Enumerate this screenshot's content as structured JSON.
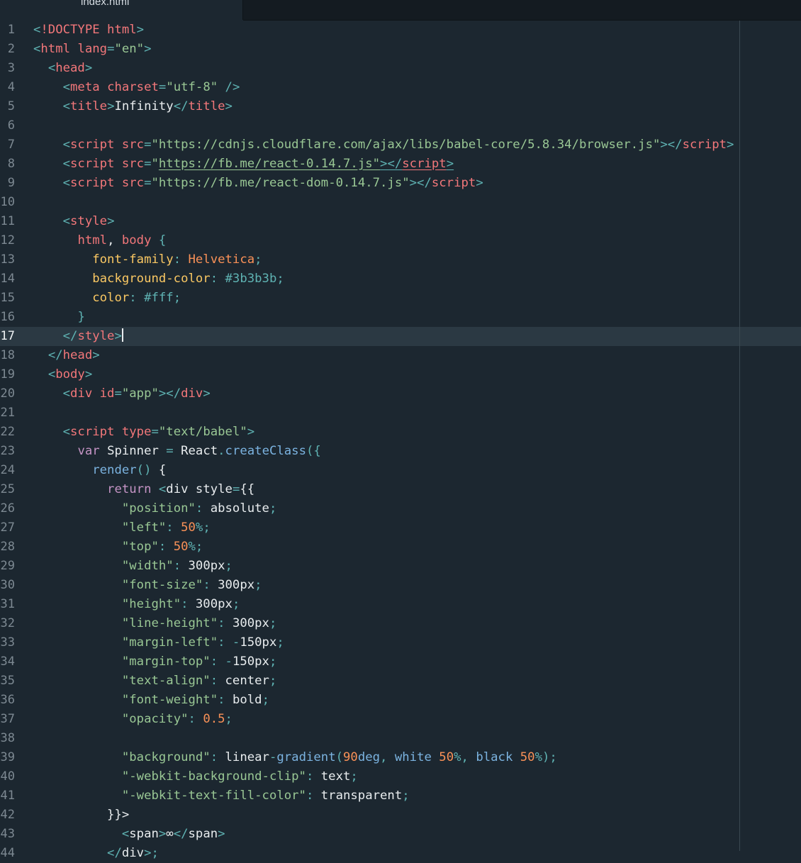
{
  "tab": {
    "filename": "index.html"
  },
  "editor": {
    "active_line": 17,
    "lines": [
      {
        "n": "1",
        "tokens": [
          [
            "p",
            "<"
          ],
          [
            "t",
            "!DOCTYPE html"
          ],
          [
            "p",
            ">"
          ]
        ]
      },
      {
        "n": "2",
        "tokens": [
          [
            "p",
            "<"
          ],
          [
            "t",
            "html "
          ],
          [
            "t",
            "lang"
          ],
          [
            "p",
            "="
          ],
          [
            "s",
            "\"en\""
          ],
          [
            "p",
            ">"
          ]
        ]
      },
      {
        "n": "3",
        "tokens": [
          [
            "",
            "  "
          ],
          [
            "p",
            "<"
          ],
          [
            "t",
            "head"
          ],
          [
            "p",
            ">"
          ]
        ]
      },
      {
        "n": "4",
        "tokens": [
          [
            "",
            "    "
          ],
          [
            "p",
            "<"
          ],
          [
            "t",
            "meta "
          ],
          [
            "t",
            "charset"
          ],
          [
            "p",
            "="
          ],
          [
            "s",
            "\"utf-8\""
          ],
          [
            "p",
            " />"
          ]
        ]
      },
      {
        "n": "5",
        "tokens": [
          [
            "",
            "    "
          ],
          [
            "p",
            "<"
          ],
          [
            "t",
            "title"
          ],
          [
            "p",
            ">"
          ],
          [
            "",
            "Infinity"
          ],
          [
            "p",
            "</"
          ],
          [
            "t",
            "title"
          ],
          [
            "p",
            ">"
          ]
        ]
      },
      {
        "n": "6",
        "tokens": []
      },
      {
        "n": "7",
        "tokens": [
          [
            "",
            "    "
          ],
          [
            "p",
            "<"
          ],
          [
            "t",
            "script "
          ],
          [
            "t",
            "src"
          ],
          [
            "p",
            "="
          ],
          [
            "s",
            "\"https://cdnjs.cloudflare.com/ajax/libs/babel-core/5.8.34/browser.js\""
          ],
          [
            "p",
            "></"
          ],
          [
            "t",
            "script"
          ],
          [
            "p",
            ">"
          ]
        ]
      },
      {
        "n": "8",
        "tokens": [
          [
            "",
            "    "
          ],
          [
            "p",
            "<"
          ],
          [
            "t",
            "script "
          ],
          [
            "t",
            "src"
          ],
          [
            "p",
            "="
          ],
          [
            "s",
            "\""
          ],
          [
            "su",
            "https://fb.me/react-0.14.7.js\""
          ],
          [
            "pu",
            "></"
          ],
          [
            "tu",
            "script"
          ],
          [
            "pu",
            ">"
          ]
        ]
      },
      {
        "n": "9",
        "tokens": [
          [
            "",
            "    "
          ],
          [
            "p",
            "<"
          ],
          [
            "t",
            "script "
          ],
          [
            "t",
            "src"
          ],
          [
            "p",
            "="
          ],
          [
            "s",
            "\"https://fb.me/react-dom-0.14.7.js\""
          ],
          [
            "p",
            "></"
          ],
          [
            "t",
            "script"
          ],
          [
            "p",
            ">"
          ]
        ]
      },
      {
        "n": "10",
        "tokens": []
      },
      {
        "n": "11",
        "tokens": [
          [
            "",
            "    "
          ],
          [
            "p",
            "<"
          ],
          [
            "t",
            "style"
          ],
          [
            "p",
            ">"
          ]
        ]
      },
      {
        "n": "12",
        "tokens": [
          [
            "",
            "      "
          ],
          [
            "t",
            "html"
          ],
          [
            "",
            ", "
          ],
          [
            "t",
            "body"
          ],
          [
            "p",
            " {"
          ]
        ]
      },
      {
        "n": "13",
        "tokens": [
          [
            "",
            "        "
          ],
          [
            "pr",
            "font-family"
          ],
          [
            "p",
            ": "
          ],
          [
            "n",
            "Helvetica"
          ],
          [
            "p",
            ";"
          ]
        ]
      },
      {
        "n": "14",
        "tokens": [
          [
            "",
            "        "
          ],
          [
            "pr",
            "background-color"
          ],
          [
            "p",
            ": "
          ],
          [
            "p",
            "#3b3b3b"
          ],
          [
            "p",
            ";"
          ]
        ]
      },
      {
        "n": "15",
        "tokens": [
          [
            "",
            "        "
          ],
          [
            "pr",
            "color"
          ],
          [
            "p",
            ": "
          ],
          [
            "p",
            "#fff"
          ],
          [
            "p",
            ";"
          ]
        ]
      },
      {
        "n": "16",
        "tokens": [
          [
            "",
            "      "
          ],
          [
            "p",
            "}"
          ]
        ]
      },
      {
        "n": "17",
        "tokens": [
          [
            "",
            "    "
          ],
          [
            "p",
            "</"
          ],
          [
            "t",
            "style"
          ],
          [
            "p",
            ">"
          ]
        ],
        "cursor": true
      },
      {
        "n": "18",
        "tokens": [
          [
            "",
            "  "
          ],
          [
            "p",
            "</"
          ],
          [
            "t",
            "head"
          ],
          [
            "p",
            ">"
          ]
        ]
      },
      {
        "n": "19",
        "tokens": [
          [
            "",
            "  "
          ],
          [
            "p",
            "<"
          ],
          [
            "t",
            "body"
          ],
          [
            "p",
            ">"
          ]
        ]
      },
      {
        "n": "20",
        "tokens": [
          [
            "",
            "    "
          ],
          [
            "p",
            "<"
          ],
          [
            "t",
            "div "
          ],
          [
            "t",
            "id"
          ],
          [
            "p",
            "="
          ],
          [
            "s",
            "\"app\""
          ],
          [
            "p",
            "></"
          ],
          [
            "t",
            "div"
          ],
          [
            "p",
            ">"
          ]
        ]
      },
      {
        "n": "21",
        "tokens": []
      },
      {
        "n": "22",
        "tokens": [
          [
            "",
            "    "
          ],
          [
            "p",
            "<"
          ],
          [
            "t",
            "script "
          ],
          [
            "t",
            "type"
          ],
          [
            "p",
            "="
          ],
          [
            "s",
            "\"text/babel\""
          ],
          [
            "p",
            ">"
          ]
        ]
      },
      {
        "n": "23",
        "tokens": [
          [
            "",
            "      "
          ],
          [
            "kw",
            "var "
          ],
          [
            "",
            "Spinner "
          ],
          [
            "p",
            "= "
          ],
          [
            "",
            "React"
          ],
          [
            "p",
            "."
          ],
          [
            "k",
            "createClass"
          ],
          [
            "p",
            "({"
          ]
        ]
      },
      {
        "n": "24",
        "tokens": [
          [
            "",
            "        "
          ],
          [
            "k",
            "render"
          ],
          [
            "p",
            "() "
          ],
          [
            "",
            "{"
          ]
        ]
      },
      {
        "n": "25",
        "tokens": [
          [
            "",
            "          "
          ],
          [
            "kw",
            "return "
          ],
          [
            "p",
            "<"
          ],
          [
            "",
            "div style"
          ],
          [
            "p",
            "="
          ],
          [
            "",
            "{{"
          ]
        ]
      },
      {
        "n": "26",
        "tokens": [
          [
            "",
            "            "
          ],
          [
            "s",
            "\"position\""
          ],
          [
            "p",
            ": "
          ],
          [
            "",
            "absolute"
          ],
          [
            "p",
            ";"
          ]
        ]
      },
      {
        "n": "27",
        "tokens": [
          [
            "",
            "            "
          ],
          [
            "s",
            "\"left\""
          ],
          [
            "p",
            ": "
          ],
          [
            "n",
            "50"
          ],
          [
            "p",
            "%;"
          ]
        ]
      },
      {
        "n": "28",
        "tokens": [
          [
            "",
            "            "
          ],
          [
            "s",
            "\"top\""
          ],
          [
            "p",
            ": "
          ],
          [
            "n",
            "50"
          ],
          [
            "p",
            "%;"
          ]
        ]
      },
      {
        "n": "29",
        "tokens": [
          [
            "",
            "            "
          ],
          [
            "s",
            "\"width\""
          ],
          [
            "p",
            ": "
          ],
          [
            "",
            "300px"
          ],
          [
            "p",
            ";"
          ]
        ]
      },
      {
        "n": "30",
        "tokens": [
          [
            "",
            "            "
          ],
          [
            "s",
            "\"font-size\""
          ],
          [
            "p",
            ": "
          ],
          [
            "",
            "300px"
          ],
          [
            "p",
            ";"
          ]
        ]
      },
      {
        "n": "31",
        "tokens": [
          [
            "",
            "            "
          ],
          [
            "s",
            "\"height\""
          ],
          [
            "p",
            ": "
          ],
          [
            "",
            "300px"
          ],
          [
            "p",
            ";"
          ]
        ]
      },
      {
        "n": "32",
        "tokens": [
          [
            "",
            "            "
          ],
          [
            "s",
            "\"line-height\""
          ],
          [
            "p",
            ": "
          ],
          [
            "",
            "300px"
          ],
          [
            "p",
            ";"
          ]
        ]
      },
      {
        "n": "33",
        "tokens": [
          [
            "",
            "            "
          ],
          [
            "s",
            "\"margin-left\""
          ],
          [
            "p",
            ": -"
          ],
          [
            "",
            "150px"
          ],
          [
            "p",
            ";"
          ]
        ]
      },
      {
        "n": "34",
        "tokens": [
          [
            "",
            "            "
          ],
          [
            "s",
            "\"margin-top\""
          ],
          [
            "p",
            ": -"
          ],
          [
            "",
            "150px"
          ],
          [
            "p",
            ";"
          ]
        ]
      },
      {
        "n": "35",
        "tokens": [
          [
            "",
            "            "
          ],
          [
            "s",
            "\"text-align\""
          ],
          [
            "p",
            ": "
          ],
          [
            "",
            "center"
          ],
          [
            "p",
            ";"
          ]
        ]
      },
      {
        "n": "36",
        "tokens": [
          [
            "",
            "            "
          ],
          [
            "s",
            "\"font-weight\""
          ],
          [
            "p",
            ": "
          ],
          [
            "",
            "bold"
          ],
          [
            "p",
            ";"
          ]
        ]
      },
      {
        "n": "37",
        "tokens": [
          [
            "",
            "            "
          ],
          [
            "s",
            "\"opacity\""
          ],
          [
            "p",
            ": "
          ],
          [
            "n",
            "0.5"
          ],
          [
            "p",
            ";"
          ]
        ]
      },
      {
        "n": "38",
        "tokens": []
      },
      {
        "n": "39",
        "tokens": [
          [
            "",
            "            "
          ],
          [
            "s",
            "\"background\""
          ],
          [
            "p",
            ": "
          ],
          [
            "",
            "linear"
          ],
          [
            "p",
            "-"
          ],
          [
            "k",
            "gradient"
          ],
          [
            "p",
            "("
          ],
          [
            "n",
            "90"
          ],
          [
            "k",
            "deg"
          ],
          [
            "p",
            ", "
          ],
          [
            "k",
            "white "
          ],
          [
            "n",
            "50"
          ],
          [
            "p",
            "%, "
          ],
          [
            "k",
            "black "
          ],
          [
            "n",
            "50"
          ],
          [
            "p",
            "%);"
          ]
        ]
      },
      {
        "n": "40",
        "tokens": [
          [
            "",
            "            "
          ],
          [
            "s",
            "\"-webkit-background-clip\""
          ],
          [
            "p",
            ": "
          ],
          [
            "",
            "text"
          ],
          [
            "p",
            ";"
          ]
        ]
      },
      {
        "n": "41",
        "tokens": [
          [
            "",
            "            "
          ],
          [
            "s",
            "\"-webkit-text-fill-color\""
          ],
          [
            "p",
            ": "
          ],
          [
            "",
            "transparent"
          ],
          [
            "p",
            ";"
          ]
        ]
      },
      {
        "n": "42",
        "tokens": [
          [
            "",
            "          "
          ],
          [
            "",
            "}}>"
          ]
        ]
      },
      {
        "n": "43",
        "tokens": [
          [
            "",
            "            "
          ],
          [
            "p",
            "<"
          ],
          [
            "",
            "span"
          ],
          [
            "p",
            ">"
          ],
          [
            "",
            "∞"
          ],
          [
            "p",
            "</"
          ],
          [
            "",
            "span"
          ],
          [
            "p",
            ">"
          ]
        ]
      },
      {
        "n": "44",
        "tokens": [
          [
            "",
            "          "
          ],
          [
            "p",
            "</"
          ],
          [
            "",
            "div"
          ],
          [
            "p",
            ">;"
          ]
        ]
      }
    ]
  }
}
